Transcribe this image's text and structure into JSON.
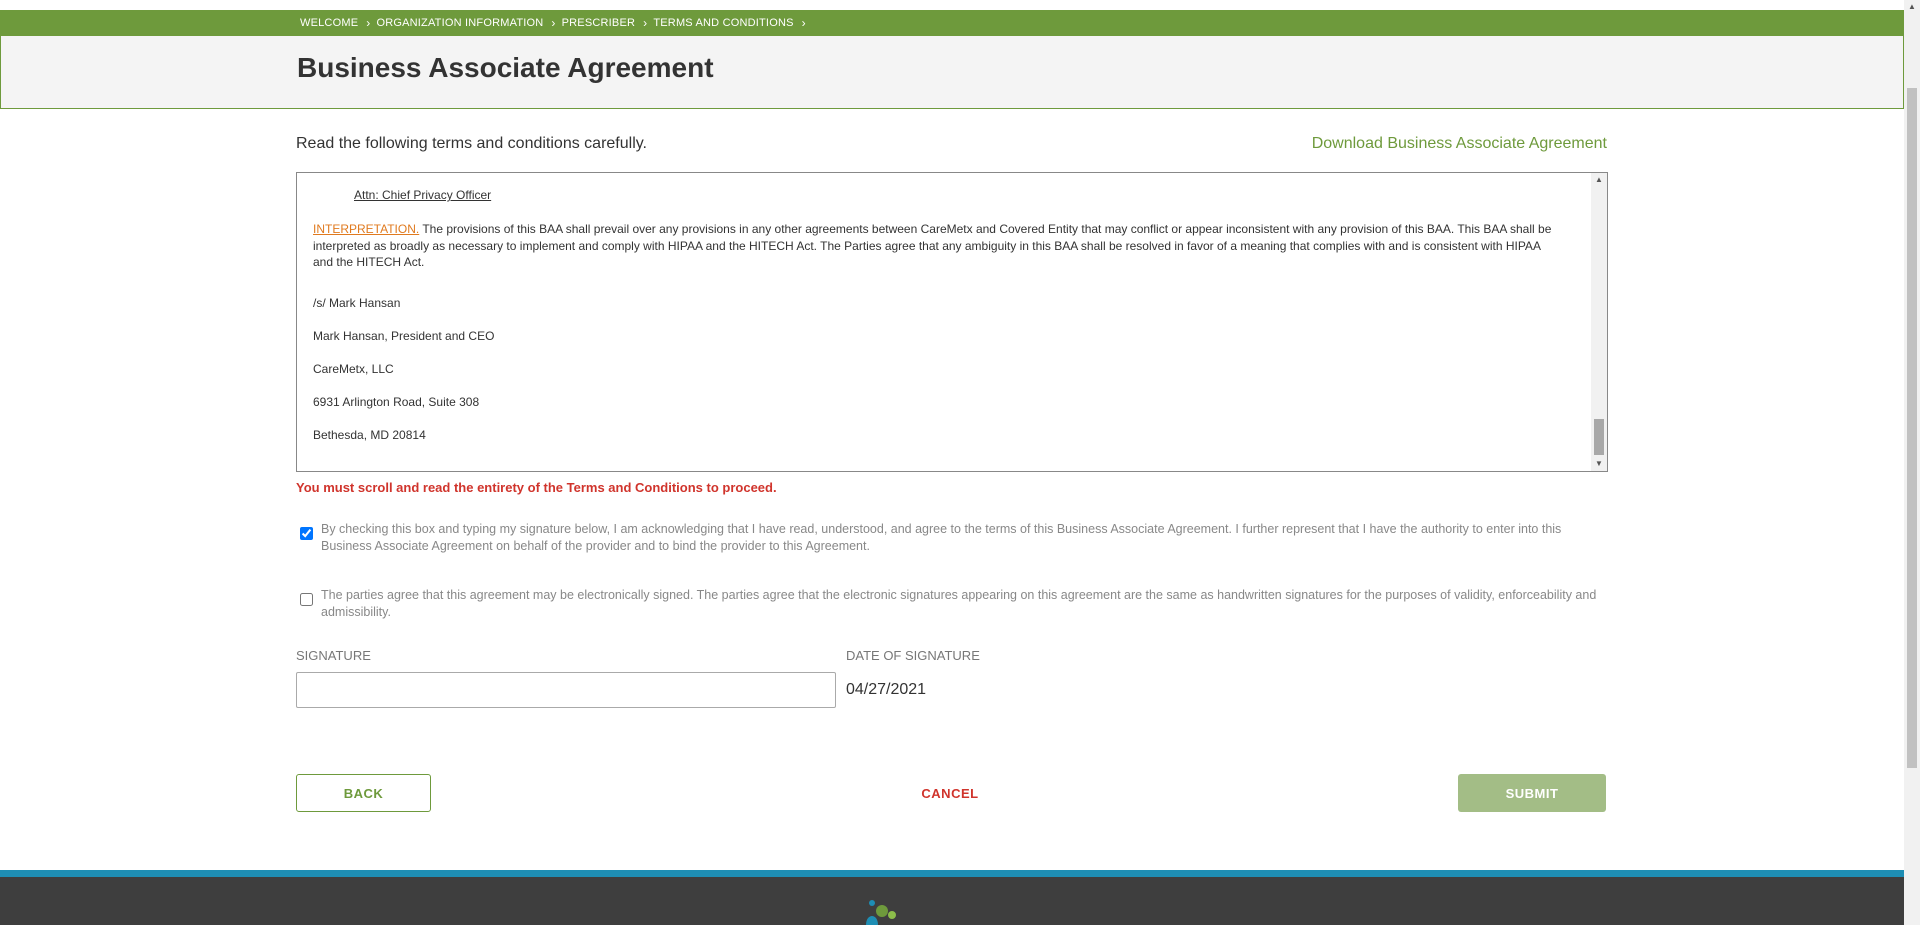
{
  "breadcrumb": {
    "items": [
      {
        "label": "WELCOME"
      },
      {
        "label": "ORGANIZATION INFORMATION"
      },
      {
        "label": "PRESCRIBER"
      },
      {
        "label": "TERMS AND CONDITIONS"
      }
    ],
    "separator": "›"
  },
  "header": {
    "title": "Business Associate Agreement"
  },
  "main": {
    "intro": "Read the following terms and conditions carefully.",
    "download_link": "Download Business Associate Agreement",
    "terms": {
      "attn": "Attn: Chief Privacy Officer",
      "interpretation_heading": "INTERPRETATION.",
      "interpretation_body": " The provisions of this BAA shall prevail over any provisions in any other agreements between CareMetx and Covered Entity that may conflict or appear inconsistent with any provision of this BAA. This BAA shall be interpreted as broadly as necessary to implement and comply with HIPAA and the HITECH Act. The Parties agree that any ambiguity in this BAA shall be resolved in favor of a meaning that complies with and is consistent with HIPAA and the HITECH Act.",
      "signature": "/s/ Mark Hansan",
      "signer": "Mark Hansan, President and CEO",
      "company": "CareMetx, LLC",
      "address1": "6931 Arlington Road, Suite 308",
      "address2": "Bethesda, MD 20814"
    },
    "scroll_warning": "You must scroll and read the entirety of the Terms and Conditions to proceed.",
    "acknowledge": {
      "checked": true,
      "text": "By checking this box and typing my signature below, I am acknowledging that I have read, understood, and agree to the terms of this Business Associate Agreement. I further represent that I have the authority to enter into this Business Associate Agreement on behalf of the provider and to bind the provider to this Agreement."
    },
    "esign": {
      "checked": false,
      "text": "The parties agree that this agreement may be electronically signed. The parties agree that the electronic signatures appearing on this agreement are the same as handwritten signatures for the purposes of validity, enforceability and admissibility."
    },
    "signature_label": "SIGNATURE",
    "signature_value": "",
    "date_label": "DATE OF SIGNATURE",
    "date_value": "04/27/2021"
  },
  "actions": {
    "back": "BACK",
    "cancel": "CANCEL",
    "submit": "SUBMIT"
  },
  "colors": {
    "brand_green": "#6e9a3c",
    "warning_red": "#d0342c",
    "interp_orange": "#e07a1f",
    "footer_dark": "#3e3e3e",
    "footer_accent": "#1e8eb4"
  },
  "icons": {
    "breadcrumb_separator": "chevron-right-icon",
    "scroll_up": "arrow-up-icon",
    "scroll_down": "arrow-down-icon",
    "footer_logo": "company-logo-icon"
  }
}
